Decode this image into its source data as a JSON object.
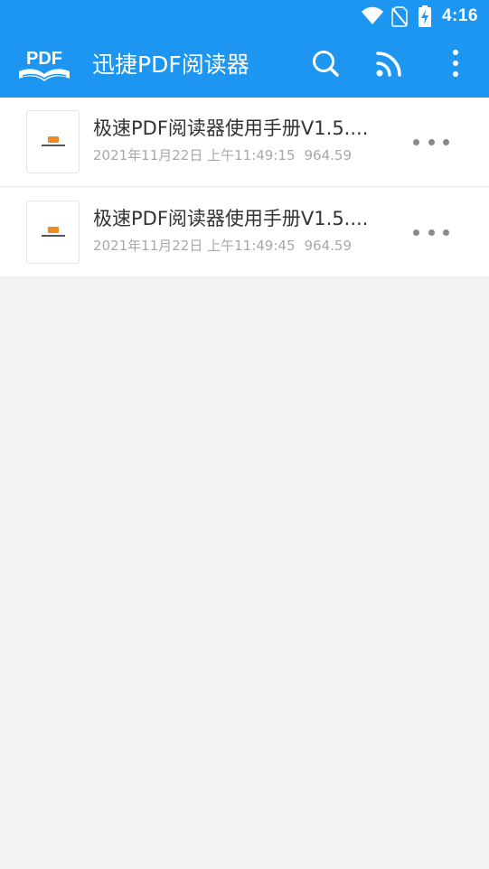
{
  "status_bar": {
    "time": "4:16",
    "icons": [
      "wifi-icon",
      "no-sim-icon",
      "battery-charging-icon"
    ]
  },
  "app_bar": {
    "logo_text": "PDF",
    "title": "迅捷PDF阅读器",
    "actions": [
      "search-icon",
      "cast-icon",
      "more-vert-icon"
    ],
    "color": "#1d96f2"
  },
  "files": [
    {
      "title": "极速PDF阅读器使用手册V1.5....",
      "date": "2021年11月22日 上午11:49:15",
      "size": "964.59"
    },
    {
      "title": "极速PDF阅读器使用手册V1.5....",
      "date": "2021年11月22日 上午11:49:45",
      "size": "964.59"
    }
  ]
}
